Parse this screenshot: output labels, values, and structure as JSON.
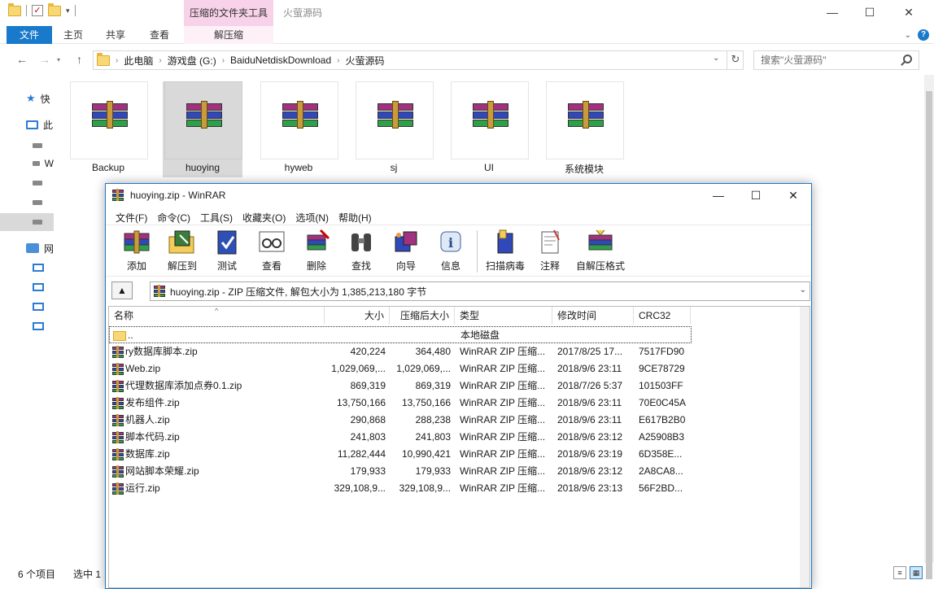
{
  "explorer": {
    "window_title": "火萤源码",
    "context_tab_header": "压缩的文件夹工具",
    "controls": {
      "minimize": "—",
      "maximize": "☐",
      "close": "✕"
    },
    "ribbon_tabs": {
      "file": "文件",
      "home": "主页",
      "share": "共享",
      "view": "查看",
      "extract": "解压缩"
    },
    "breadcrumb": [
      "此电脑",
      "游戏盘 (G:)",
      "BaiduNetdiskDownload",
      "火萤源码"
    ],
    "search_placeholder": "搜索\"火萤源码\"",
    "nav_items": [
      "快",
      "此",
      "",
      "W",
      "",
      "",
      "",
      "网",
      "",
      "",
      "",
      ""
    ],
    "tiles": [
      {
        "label": "Backup"
      },
      {
        "label": "huoying"
      },
      {
        "label": "hyweb"
      },
      {
        "label": "sj"
      },
      {
        "label": "UI"
      },
      {
        "label": "系统模块"
      }
    ],
    "status": {
      "count": "6 个项目",
      "selected": "选中 1"
    }
  },
  "winrar": {
    "title": "huoying.zip - WinRAR",
    "menu": [
      "文件(F)",
      "命令(C)",
      "工具(S)",
      "收藏夹(O)",
      "选项(N)",
      "帮助(H)"
    ],
    "toolbar": [
      "添加",
      "解压到",
      "测试",
      "查看",
      "删除",
      "查找",
      "向导",
      "信息",
      "扫描病毒",
      "注释",
      "自解压格式"
    ],
    "path_text": "huoying.zip - ZIP 压缩文件, 解包大小为 1,385,213,180 字节",
    "columns": {
      "name": "名称",
      "size": "大小",
      "packed": "压缩后大小",
      "type": "类型",
      "modified": "修改时间",
      "crc": "CRC32"
    },
    "parent_row": {
      "name": "..",
      "type": "本地磁盘"
    },
    "files": [
      {
        "name": "ry数据库脚本.zip",
        "size": "420,224",
        "packed": "364,480",
        "type": "WinRAR ZIP 压缩...",
        "modified": "2017/8/25 17...",
        "crc": "7517FD90"
      },
      {
        "name": "Web.zip",
        "size": "1,029,069,...",
        "packed": "1,029,069,...",
        "type": "WinRAR ZIP 压缩...",
        "modified": "2018/9/6 23:11",
        "crc": "9CE78729"
      },
      {
        "name": "代理数据库添加点券0.1.zip",
        "size": "869,319",
        "packed": "869,319",
        "type": "WinRAR ZIP 压缩...",
        "modified": "2018/7/26 5:37",
        "crc": "101503FF"
      },
      {
        "name": "发布组件.zip",
        "size": "13,750,166",
        "packed": "13,750,166",
        "type": "WinRAR ZIP 压缩...",
        "modified": "2018/9/6 23:11",
        "crc": "70E0C45A"
      },
      {
        "name": "机器人.zip",
        "size": "290,868",
        "packed": "288,238",
        "type": "WinRAR ZIP 压缩...",
        "modified": "2018/9/6 23:11",
        "crc": "E617B2B0"
      },
      {
        "name": "脚本代码.zip",
        "size": "241,803",
        "packed": "241,803",
        "type": "WinRAR ZIP 压缩...",
        "modified": "2018/9/6 23:12",
        "crc": "A25908B3"
      },
      {
        "name": "数据库.zip",
        "size": "11,282,444",
        "packed": "10,990,421",
        "type": "WinRAR ZIP 压缩...",
        "modified": "2018/9/6 23:19",
        "crc": "6D358E..."
      },
      {
        "name": "网站脚本荣耀.zip",
        "size": "179,933",
        "packed": "179,933",
        "type": "WinRAR ZIP 压缩...",
        "modified": "2018/9/6 23:12",
        "crc": "2A8CA8..."
      },
      {
        "name": "运行.zip",
        "size": "329,108,9...",
        "packed": "329,108,9...",
        "type": "WinRAR ZIP 压缩...",
        "modified": "2018/9/6 23:13",
        "crc": "56F2BD..."
      }
    ]
  }
}
